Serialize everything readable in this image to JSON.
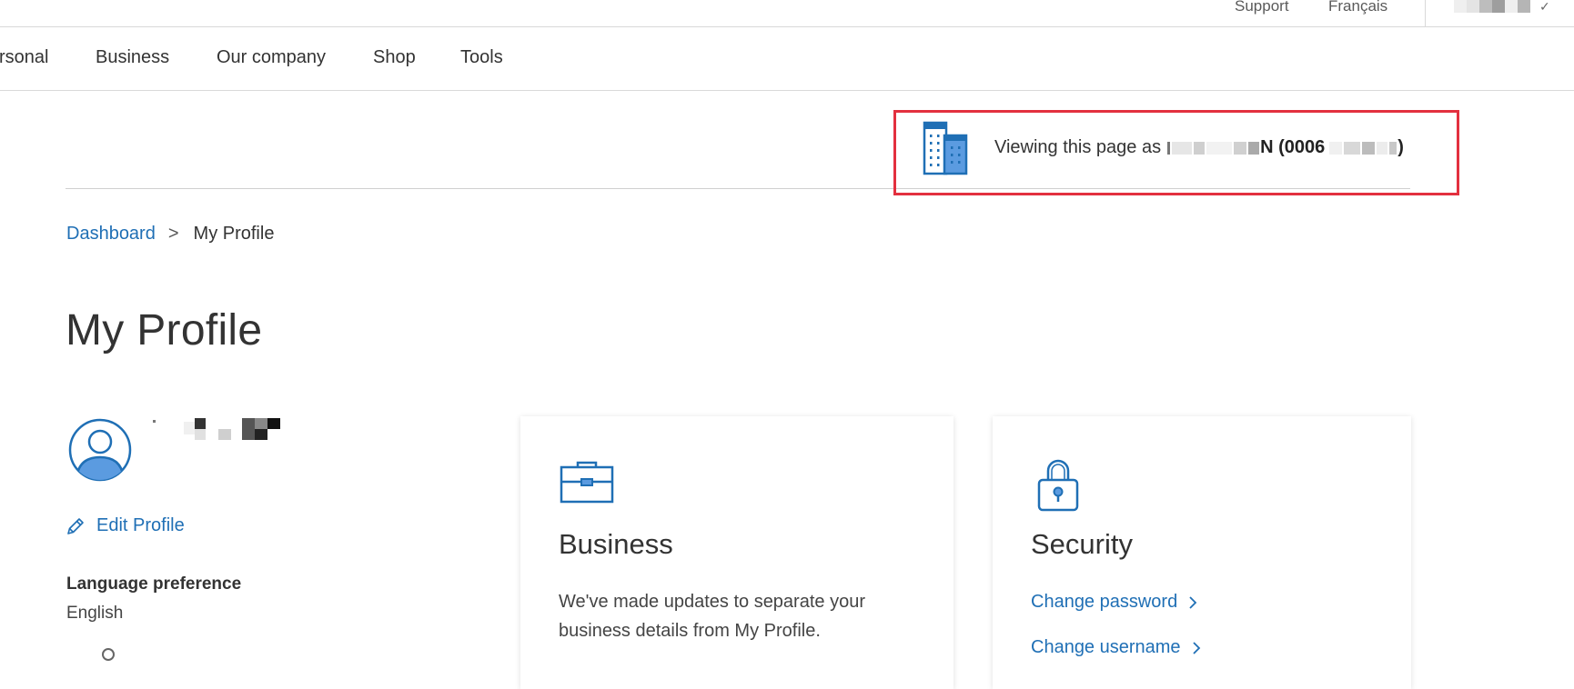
{
  "utility": {
    "support": "Support",
    "language": "Français",
    "account_check": "✓"
  },
  "nav": {
    "items": [
      "rsonal",
      "Business",
      "Our company",
      "Shop",
      "Tools"
    ]
  },
  "viewing": {
    "prefix": "Viewing this page as",
    "name_end": "N (0006",
    "suffix": ")"
  },
  "breadcrumb": {
    "dashboard": "Dashboard",
    "separator": ">",
    "current": "My Profile"
  },
  "page_title": "My Profile",
  "profile": {
    "edit_label": "Edit Profile",
    "language_label": "Language preference",
    "language_value": "English"
  },
  "cards": {
    "business": {
      "title": "Business",
      "text_line1": "We've made updates to separate your",
      "text_line2": "business details from My Profile."
    },
    "security": {
      "title": "Security",
      "change_password": "Change password",
      "change_username": "Change username"
    }
  },
  "colors": {
    "accent": "#1f6fb5",
    "highlight_border": "#e3303f",
    "icon_fill": "#5b9be0"
  },
  "icons": {
    "building": "building-icon",
    "avatar": "user-avatar-icon",
    "edit": "pencil-icon",
    "briefcase": "briefcase-icon",
    "lock": "lock-icon",
    "chevron": "chevron-right-icon"
  }
}
